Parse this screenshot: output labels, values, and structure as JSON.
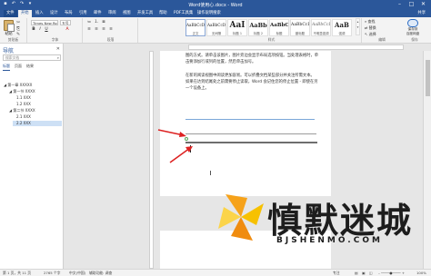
{
  "app": {
    "title": "Word使用心.docx - Word",
    "qat_icons": [
      "save-icon",
      "undo-icon",
      "redo-icon",
      "customize-icon"
    ],
    "window_controls": [
      "minimize-icon",
      "restore-icon",
      "close-icon"
    ]
  },
  "tabs": [
    {
      "label": "文件"
    },
    {
      "label": "开始"
    },
    {
      "label": "插入"
    },
    {
      "label": "设计"
    },
    {
      "label": "布局"
    },
    {
      "label": "引用"
    },
    {
      "label": "邮件"
    },
    {
      "label": "审阅"
    },
    {
      "label": "视图"
    },
    {
      "label": "开发工具"
    },
    {
      "label": "帮助"
    },
    {
      "label": "PDF工具集"
    },
    {
      "label": "操作说明搜索"
    }
  ],
  "share_label": "共享",
  "ribbon": {
    "clipboard": {
      "paste_label": "粘贴",
      "group_label": "剪贴板"
    },
    "font": {
      "font_name": "Times New Ro",
      "font_size": "五号",
      "group_label": "字体",
      "buttons": [
        "B",
        "I",
        "U",
        "A"
      ]
    },
    "paragraph": {
      "group_label": "段落"
    },
    "styles": {
      "group_label": "样式",
      "items": [
        {
          "sample": "AaBbCcDd",
          "name": "正文"
        },
        {
          "sample": "AaBbCcDd",
          "name": "无间隔"
        },
        {
          "sample": "AaI",
          "name": "标题 1"
        },
        {
          "sample": "AaBb",
          "name": "标题 2"
        },
        {
          "sample": "AaBbC",
          "name": "标题"
        },
        {
          "sample": "AaBbCcD",
          "name": "副标题"
        },
        {
          "sample": "AaBbCcD",
          "name": "不明显强调"
        },
        {
          "sample": "AaB",
          "name": "强调"
        }
      ]
    },
    "editing": {
      "items": [
        "查找",
        "替换",
        "选择"
      ],
      "group_label": "编辑"
    },
    "save": {
      "label": "保存到\n百度网盘",
      "group_label": "保存"
    }
  },
  "nav_pane": {
    "title": "导航",
    "search_placeholder": "搜索文档",
    "tabs": [
      "标题",
      "页面",
      "结果"
    ],
    "outline": [
      {
        "label": "◢ 第一章 XXXXX"
      },
      {
        "label": "◢ 第一节 XXXX"
      },
      {
        "label": "1.1 XXX"
      },
      {
        "label": "1.2 XXX"
      },
      {
        "label": "◢ 第二节 XXXX"
      },
      {
        "label": "2.1 XXX"
      },
      {
        "label": "2.2 XXX"
      }
    ]
  },
  "document": {
    "lines": [
      "图的方式。请单击该图片，图片旁边会显示布局选项按钮。当处理表格时，单",
      "击要添加行或列的位置，然后单击加号。",
      "在新的阅读视图中阅读更加容易。可以折叠文档某些部分并关注所需文本。",
      "如果在达到结尾处之前需要停止读取，Word 会记住您的停止位置 - 即使在另",
      "一个设备上。"
    ]
  },
  "watermark": {
    "text_cn": "慎默迷城",
    "text_en": "BJSHENMO.COM"
  },
  "status_bar": {
    "page": "第 1 页，共 11 页",
    "words": "2765 个字",
    "language": "中文(中国)",
    "accessibility": "辅助功能: 调查",
    "focus": "专注",
    "zoom": "100%"
  }
}
